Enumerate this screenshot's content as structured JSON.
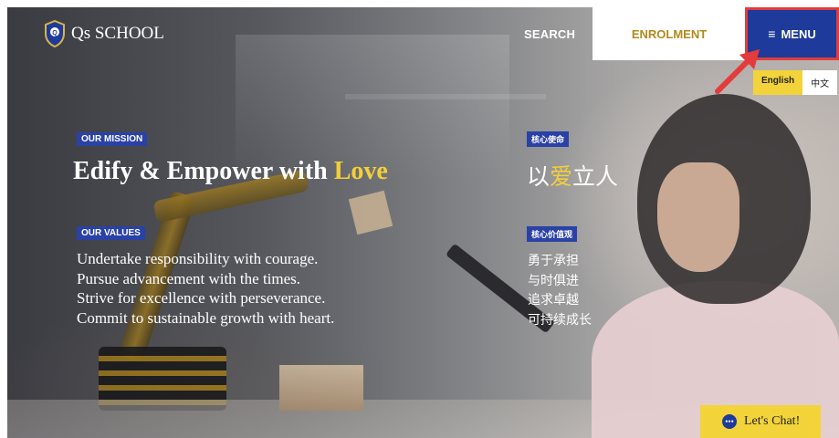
{
  "brand": {
    "name": "Qs SCHOOL",
    "logo_icon": "school-crest-icon"
  },
  "nav": {
    "search_label": "SEARCH",
    "enrolment_label": "ENROLMENT",
    "menu_label": "MENU",
    "menu_icon": "hamburger-icon"
  },
  "language": {
    "english": "English",
    "chinese": "中文"
  },
  "mission": {
    "tag": "OUR MISSION",
    "title_main": "Edify & Empower with ",
    "title_highlight": "Love",
    "tag_zh": "核心使命",
    "title_zh_1": "以",
    "title_zh_highlight": "爱",
    "title_zh_2": "立人"
  },
  "values": {
    "tag": "OUR VALUES",
    "lines": [
      "Undertake responsibility with courage.",
      "Pursue advancement with the times.",
      "Strive for excellence with perseverance.",
      "Commit to sustainable growth with heart."
    ],
    "tag_zh": "核心价值观",
    "lines_zh": [
      "勇于承担",
      "与时俱进",
      "追求卓越",
      "可持续成长"
    ]
  },
  "chat": {
    "label": "Let's Chat!",
    "icon": "chat-bubble-icon"
  },
  "colors": {
    "accent_blue": "#1e3a9a",
    "accent_gold": "#f2cf3b",
    "highlight_red": "#e23c3c"
  }
}
